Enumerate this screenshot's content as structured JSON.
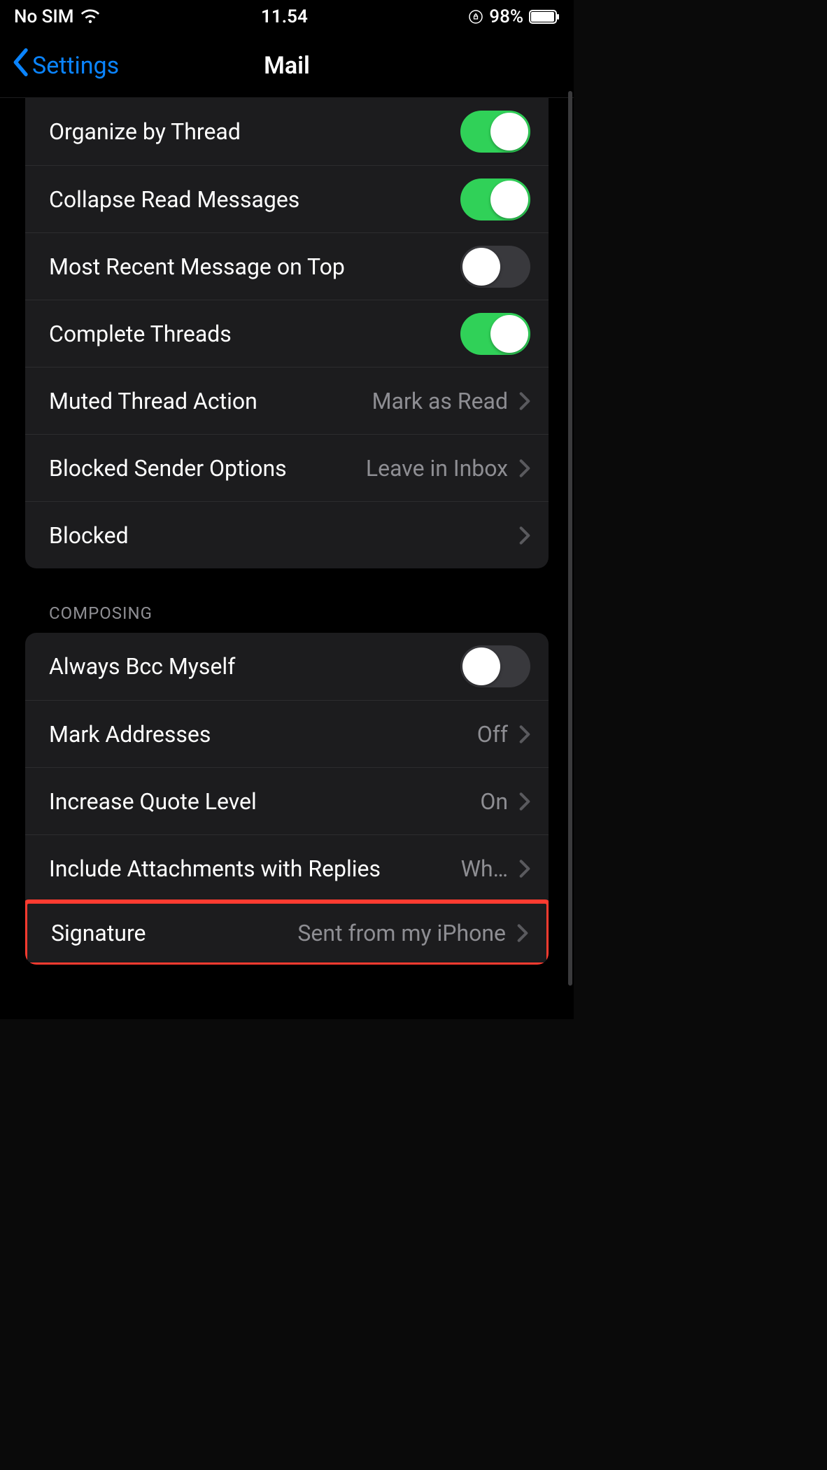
{
  "status": {
    "carrier": "No SIM",
    "time": "11.54",
    "battery_pct": "98%"
  },
  "nav": {
    "back_label": "Settings",
    "title": "Mail"
  },
  "threading": {
    "organize_by_thread": {
      "label": "Organize by Thread",
      "on": true
    },
    "collapse_read": {
      "label": "Collapse Read Messages",
      "on": true
    },
    "most_recent_top": {
      "label": "Most Recent Message on Top",
      "on": false
    },
    "complete_threads": {
      "label": "Complete Threads",
      "on": true
    },
    "muted_action": {
      "label": "Muted Thread Action",
      "value": "Mark as Read"
    },
    "blocked_sender": {
      "label": "Blocked Sender Options",
      "value": "Leave in Inbox"
    },
    "blocked": {
      "label": "Blocked"
    }
  },
  "composing": {
    "header": "COMPOSING",
    "always_bcc": {
      "label": "Always Bcc Myself",
      "on": false
    },
    "mark_addresses": {
      "label": "Mark Addresses",
      "value": "Off"
    },
    "increase_quote": {
      "label": "Increase Quote Level",
      "value": "On"
    },
    "include_attachments": {
      "label": "Include Attachments with Replies",
      "value": "Wh…"
    },
    "signature": {
      "label": "Signature",
      "value": "Sent from my iPhone"
    }
  }
}
